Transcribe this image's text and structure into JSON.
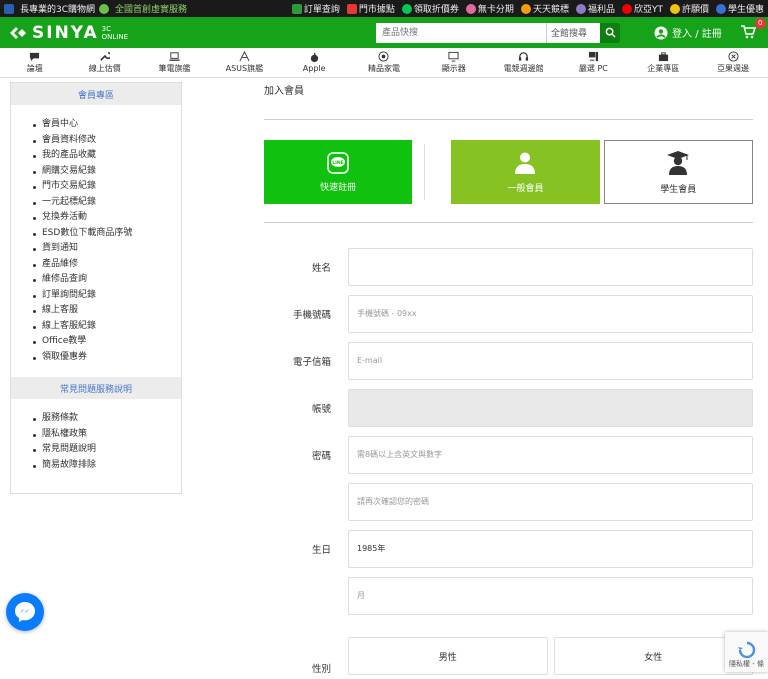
{
  "topbar": {
    "left": [
      "長專業的3C購物網",
      "全國首創虛實服務"
    ],
    "links": [
      "訂單查詢",
      "門市據點",
      "領取折價券",
      "無卡分期",
      "天天競標",
      "福利品",
      "欣亞YT",
      "許願價",
      "學生優惠"
    ],
    "colors": {
      "bg": "#1a1a1a",
      "accent": "#16a31a"
    }
  },
  "header": {
    "logo": "SINYA",
    "logo_sub_1": "3C",
    "logo_sub_2": "ONLINE",
    "search_placeholder": "產品快搜",
    "search_scope": "全館搜尋",
    "login_label": "登入 / 註冊",
    "cart_count": "0"
  },
  "nav": {
    "items": [
      {
        "label": "論壇",
        "icon": "chat-icon"
      },
      {
        "label": "線上估價",
        "icon": "wrench-icon"
      },
      {
        "label": "筆電旗艦",
        "icon": "laptop-icon"
      },
      {
        "label": "ASUS旗艦",
        "icon": "asus-icon"
      },
      {
        "label": "Apple",
        "icon": "apple-icon"
      },
      {
        "label": "精品家電",
        "icon": "appliance-icon"
      },
      {
        "label": "顯示器",
        "icon": "monitor-icon"
      },
      {
        "label": "電競週邊館",
        "icon": "headset-icon"
      },
      {
        "label": "嚴選 PC",
        "icon": "pc-icon"
      },
      {
        "label": "企業專區",
        "icon": "briefcase-icon"
      },
      {
        "label": "亞果週邊",
        "icon": "accessory-icon"
      }
    ]
  },
  "sidebar": {
    "member_title": "會員專區",
    "member_items": [
      "會員中心",
      "會員資料修改",
      "我的產品收藏",
      "網購交易紀錄",
      "門市交易紀錄",
      "一元起標紀錄",
      "兌換券活動",
      "ESD數位下載商品序號",
      "貨到通知",
      "產品維修",
      "維修品查詢",
      "訂單詢問紀錄",
      "線上客服",
      "線上客服紀錄",
      "Office教學",
      "領取優惠券"
    ],
    "faq_title": "常見問題服務說明",
    "faq_items": [
      "服務條款",
      "隱私權政策",
      "常見問題說明",
      "簡易故障排除"
    ]
  },
  "main": {
    "title": "加入會員",
    "tabs": {
      "line": "快速註冊",
      "line_badge": "LINE",
      "general": "一般會員",
      "student": "學生會員"
    }
  },
  "form": {
    "name_label": "姓名",
    "phone_label": "手機號碼",
    "phone_placeholder": "手機號碼 - 09xx",
    "email_label": "電子信箱",
    "email_placeholder": "E-mail",
    "account_label": "帳號",
    "password_label": "密碼",
    "password_placeholder": "需8碼以上含英文與數字",
    "password_confirm_placeholder": "請再次確認您的密碼",
    "birthday_label": "生日",
    "birth_year": "1985年",
    "birth_month": "月",
    "gender_label": "性別",
    "male": "男性",
    "female": "女性"
  },
  "recaptcha": {
    "label": "隱私權 - 條"
  }
}
